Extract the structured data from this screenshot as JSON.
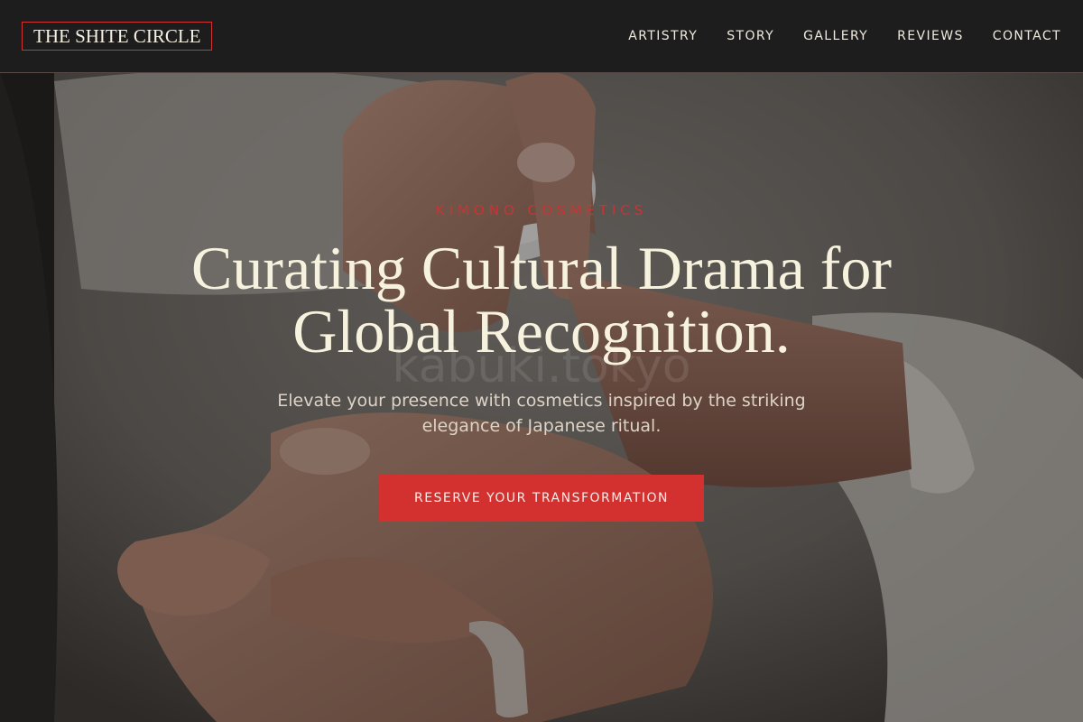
{
  "header": {
    "logo": "THE SHITE CIRCLE",
    "nav": [
      "ARTISTRY",
      "STORY",
      "GALLERY",
      "REVIEWS",
      "CONTACT"
    ]
  },
  "hero": {
    "eyebrow": "KIMONO COSMETICS",
    "headline": "Curating Cultural Drama for Global Recognition.",
    "watermark": "kabuki.tokyo",
    "subtext": "Elevate your presence with cosmetics inspired by the striking elegance of Japanese ritual.",
    "cta_label": "RESERVE YOUR TRANSFORMATION"
  },
  "colors": {
    "accent": "#d33030",
    "header_bg": "#1d1d1d",
    "headline": "#f7f2dd"
  }
}
